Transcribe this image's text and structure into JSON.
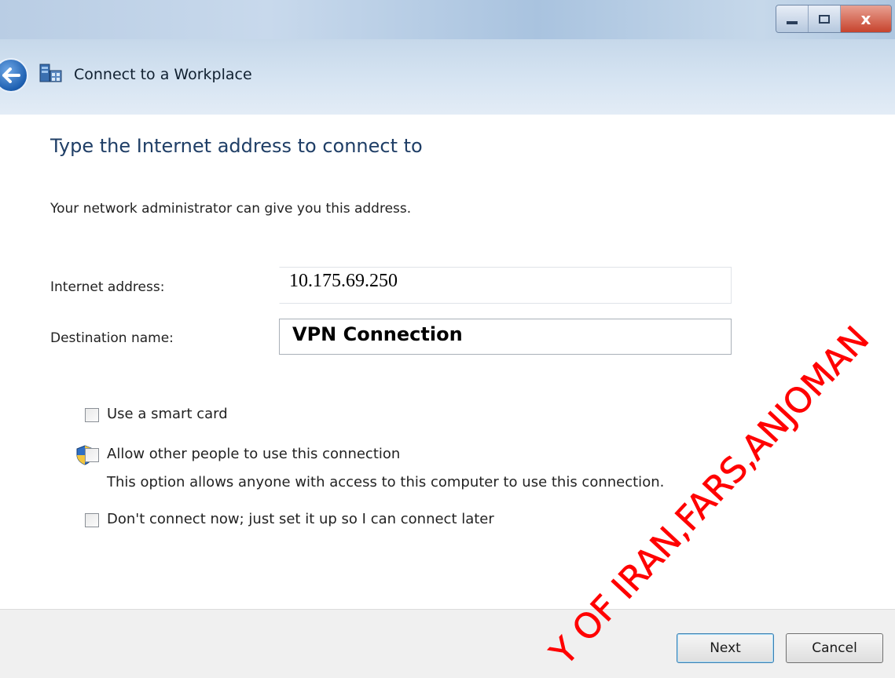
{
  "window": {
    "app_title": "Connect to a Workplace",
    "controls": {
      "minimize_icon": "minimize-icon",
      "maximize_icon": "maximize-icon",
      "close_glyph": "x"
    }
  },
  "page": {
    "heading": "Type the Internet address to connect to",
    "subtext": "Your network administrator can give you this address."
  },
  "form": {
    "internet_address_label": "Internet address:",
    "internet_address_value": "10.175.69.250",
    "destination_name_label": "Destination name:",
    "destination_name_value": "VPN Connection"
  },
  "options": {
    "smart_card": {
      "label": "Use a smart card",
      "checked": false
    },
    "allow_others": {
      "label": "Allow other people to use this connection",
      "checked": false
    },
    "allow_others_description": "This option allows anyone with access to this computer to use this connection.",
    "connect_later": {
      "label": "Don't connect now; just set it up so I can connect later",
      "checked": false
    }
  },
  "footer": {
    "next_label": "Next",
    "cancel_label": "Cancel"
  },
  "watermark": {
    "text": "Y OF IRAN,FARS,ANJOMAN",
    "color": "#ff0000"
  },
  "colors": {
    "heading": "#1f3e66",
    "titlebar": "#c6d8ea"
  }
}
